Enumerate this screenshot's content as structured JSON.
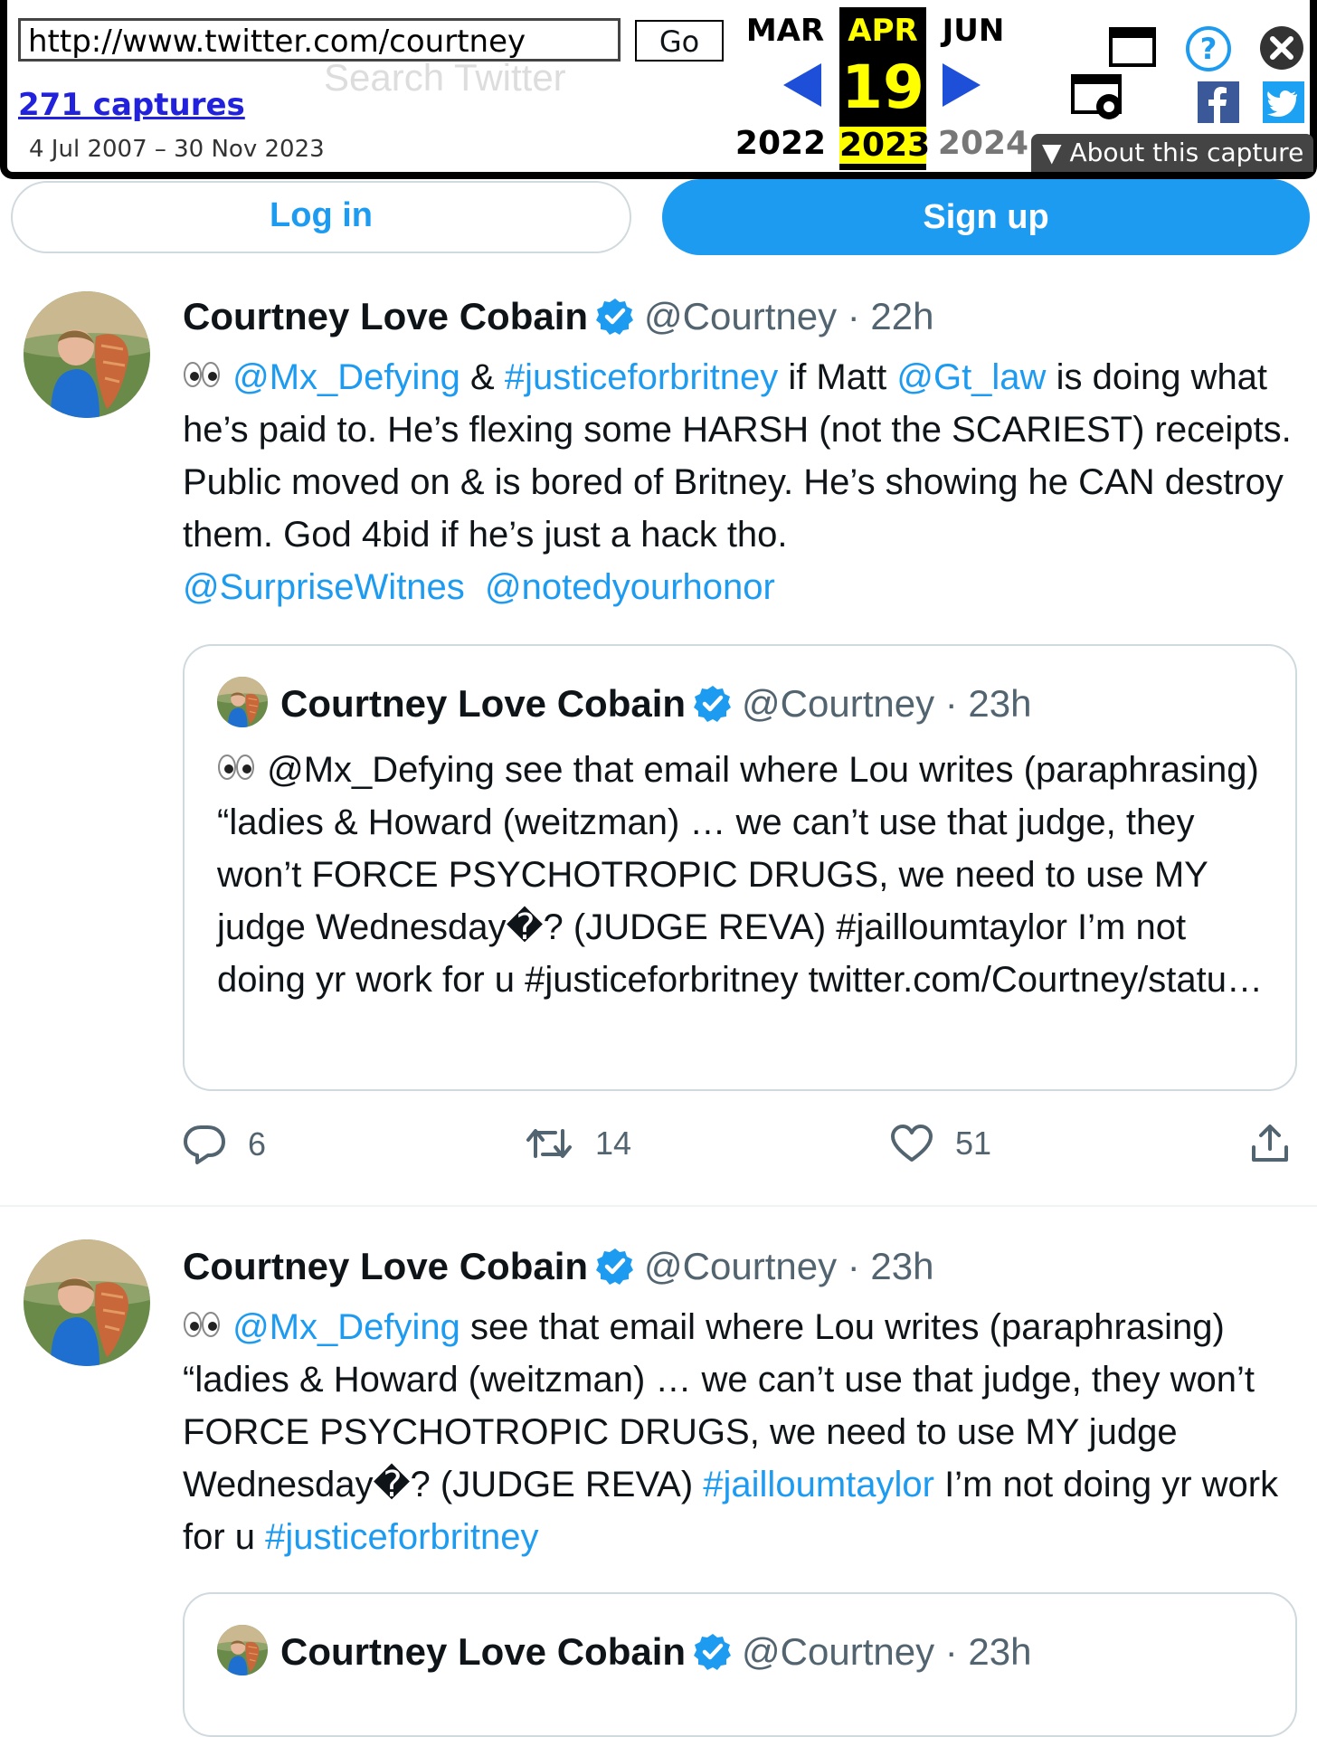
{
  "wayback": {
    "url": "http://www.twitter.com/courtney",
    "go_label": "Go",
    "captures_link": "271 captures",
    "date_range": "4 Jul 2007 – 30 Nov 2023",
    "prev_month": "MAR",
    "current_month": "APR",
    "next_month": "JUN",
    "current_day": "19",
    "prev_year": "2022",
    "current_year": "2023",
    "next_year": "2024",
    "about_label": "About this capture",
    "ghost_search": "Search Twitter"
  },
  "auth": {
    "login_label": "Log in",
    "signup_label": "Sign up"
  },
  "tweets": [
    {
      "name": "Courtney Love Cobain",
      "handle": "@Courtney",
      "time": "· 22h",
      "text_parts": {
        "p1": "@Mx_Defying",
        "p2": " & ",
        "p3": "#justiceforbritney",
        "p4": " if Matt ",
        "p5": "@Gt_law",
        "p6": " is doing what he’s paid to. He’s flexing some HARSH (not the SCARIEST) receipts. Public moved on & is bored of Britney. He’s showing he CAN destroy them. God 4bid if he’s just a hack tho. ",
        "p7": "@SurpriseWitnes",
        "p8": "@notedyourhonor"
      },
      "quote": {
        "name": "Courtney Love Cobain",
        "handle": "@Courtney",
        "time": "· 23h",
        "text": "@Mx_Defying see that email where Lou writes (paraphrasing) “ladies & Howard (weitzman) … we can’t use that judge, they won’t FORCE PSYCHOTROPIC DRUGS, we need to use MY judge Wednesday�? (JUDGE REVA) #jailloumtaylor I’m not doing yr work for u #justiceforbritney twitter.com/Courtney/statu…"
      },
      "replies": "6",
      "retweets": "14",
      "likes": "51"
    },
    {
      "name": "Courtney Love Cobain",
      "handle": "@Courtney",
      "time": "· 23h",
      "text_parts": {
        "p1": "@Mx_Defying",
        "p2": " see that email where Lou writes (paraphrasing) “ladies & Howard (weitzman) … we can’t use that judge, they won’t FORCE PSYCHOTROPIC DRUGS, we need to use MY judge Wednesday�? (JUDGE REVA) ",
        "p3": "#jailloumtaylor",
        "p4": " I’m not doing yr work for u  ",
        "p5": "#justiceforbritney"
      },
      "quote": {
        "name": "Courtney Love Cobain",
        "handle": "@Courtney",
        "time": "· 23h"
      }
    }
  ],
  "colors": {
    "accent": "#1d9bf0",
    "text": "#0f1419",
    "muted": "#536471",
    "wayback_highlight": "#ffff00"
  }
}
